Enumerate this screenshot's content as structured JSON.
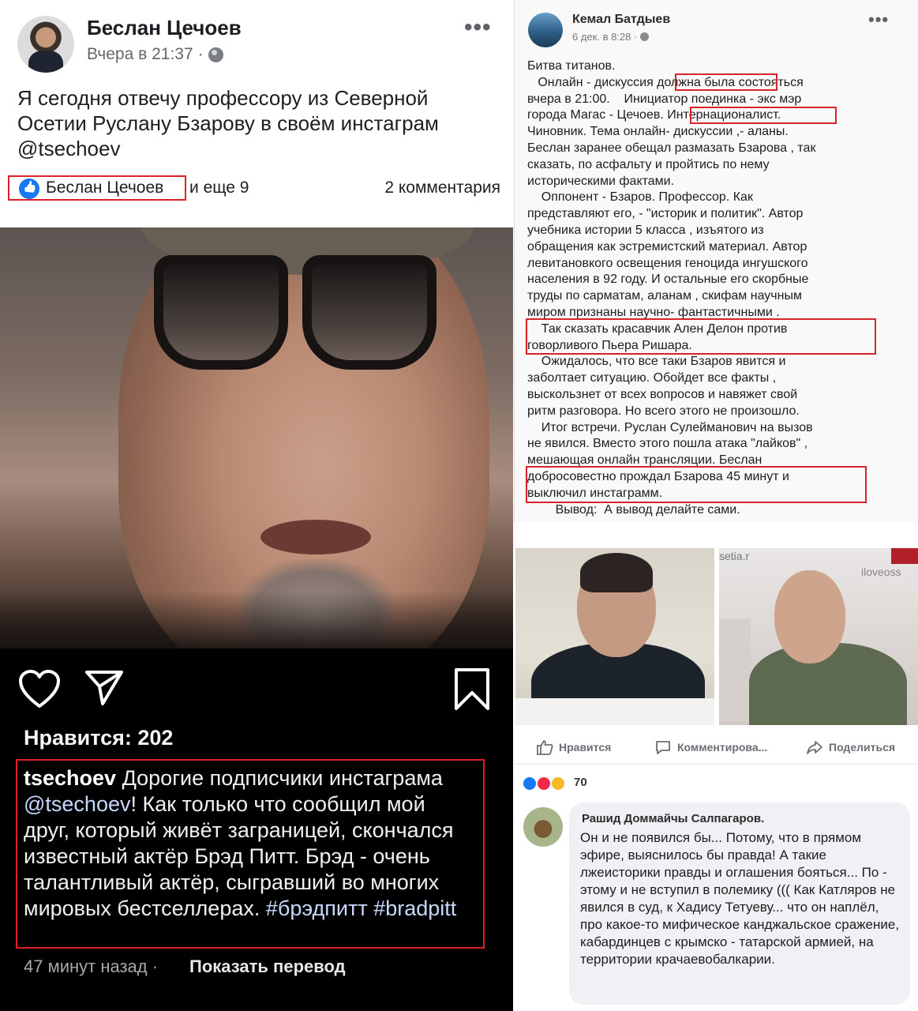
{
  "left_post": {
    "author": "Беслан Цечоев",
    "timestamp": "Вчера в 21:37 ·",
    "menu": "•••",
    "text": "Я сегодня отвечу профессору из Северной Осетии Руслану Бзарову в своём инстаграм @tsechoev",
    "reaction_name": "Беслан Цечоев",
    "reaction_more": "и еще 9",
    "comments": "2 комментария"
  },
  "instagram": {
    "likes": "Нравится: 202",
    "caption_user": "tsechoev",
    "caption_part1": " Дорогие подписчики инстаграма ",
    "caption_mention": "@tsechoev",
    "caption_part2": "! Как только что сообщил мой друг, который живёт заграницей, скончался известный актёр Брэд Питт. Брэд - очень талантливый актёр, сыгравший во многих мировых бестселлерах. ",
    "caption_tags": "#брэдпитт #bradpitt",
    "time": "47 минут назад ·",
    "translate": "Показать перевод"
  },
  "right_post": {
    "author": "Кемал Батдыев",
    "timestamp": "6 дек. в 8:28 ·",
    "menu": "•••",
    "text": "Битва титанов.\n   Онлайн - дискуссия должна была состояться\nвчера в 21:00.    Инициатор поединка - экс мэр\nгорода Магас - Цечоев. Интернационалист.\nЧиновник. Тема онлайн- дискуссии ,- аланы.\nБеслан заранее обещал размазать Бзарова , так\nсказать, по асфальту и пройтись по нему\nисторическими фактами.\n    Оппонент - Бзаров. Профессор. Как\nпредставляют его, - \"историк и политик\". Автор\nучебника истории 5 класса , изъятого из\nобращения как эстремистский материал. Автор\nлевитановкого освещения геноцида ингушского\nнаселения в 92 году. И остальные его скорбные\nтруды по сарматам, аланам , скифам научным\nмиром признаны научно- фантастичными .\n    Так сказать красавчик Ален Делон против\nговорливого Пьера Ришара.\n    Ожидалось, что все таки Бзаров явится и\nзаболтает ситуацию. Обойдет все факты ,\nвыскользнет от всех вопросов и навяжет свой\nритм разговора. Но всего этого не произошло.\n    Итог встречи. Руслан Сулейманович на вызов\nне явился. Вместо этого пошла атака \"лайков\" ,\nмешающая онлайн трансляции. Беслан\nдобросовестно прождал Бзарова 45 минут и\nвыключил инстаграмм.\n        Вывод:  А вывод делайте сами."
  },
  "photos": {
    "right_photo_text_1": "setia.r",
    "right_photo_text_2": "iloveoss"
  },
  "actions": {
    "like": "Нравится",
    "comment": "Комментирова...",
    "share": "Поделиться"
  },
  "reactions": {
    "total": "70"
  },
  "comment": {
    "author": "Рашид Доммайчы Салпагаров.",
    "text": "Он и не появился бы... Потому, что в прямом эфире, выяснилось бы правда! А такие лжеисторики правды и оглашения бояться... По - этому и не вступил в полемику ((( Как Катляров не явился в суд, к Хадису Тетуеву... что он наплёл, про какое-то мифическое канджальское сражение, кабардинцев с крымско - татарской армией, на территории крачаевобалкарии."
  }
}
